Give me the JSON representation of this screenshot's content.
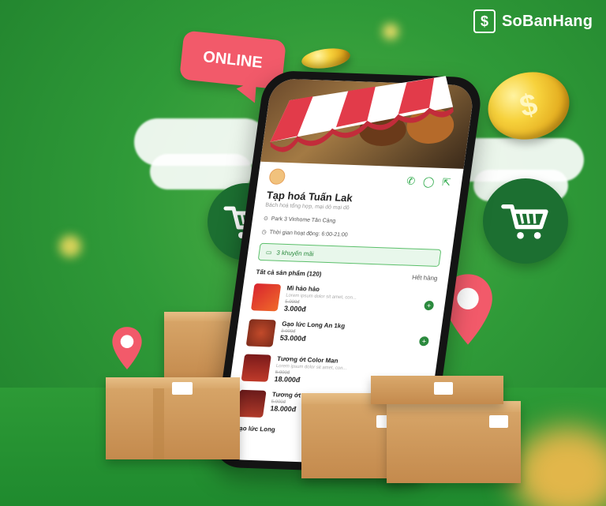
{
  "brand": {
    "name": "SoBanHang",
    "mark": "$"
  },
  "bubble": {
    "text": "ONLINE"
  },
  "coins": {
    "symbol": "$"
  },
  "shop": {
    "name": "Tạp hoá Tuấn Lak",
    "description": "Bách hoá tổng hợp, mại dô mại dô",
    "address": "Park 3 Vinhome Tân Cảng",
    "hours": "Thời gian hoạt động: 6:00-21:00",
    "promo": "3 khuyến mãi"
  },
  "products": {
    "header": "Tất cả sản phẩm (120)",
    "sort": "Hết hàng",
    "items": [
      {
        "name": "Mì hảo hảo",
        "desc": "Lorem ipsum dolor sit amet, con...",
        "old_price": "5.000đ",
        "price": "3.000đ"
      },
      {
        "name": "Gạo lức Long An 1kg",
        "desc": "",
        "old_price": "3.000đ",
        "price": "53.000đ"
      },
      {
        "name": "Tương ớt Color Man",
        "desc": "Lorem ipsum dolor sit amet, con...",
        "old_price": "5.000đ",
        "price": "18.000đ"
      },
      {
        "name": "Tương ớt",
        "desc": "",
        "old_price": "5.000đ",
        "price": "18.000đ"
      },
      {
        "name": "Gạo lức Long",
        "desc": "",
        "old_price": "",
        "price": ""
      }
    ]
  },
  "colors": {
    "brand_green": "#2f9a38",
    "dark_green": "#1c6f31",
    "accent_red": "#f25a6a",
    "gold": "#f7d23c"
  }
}
